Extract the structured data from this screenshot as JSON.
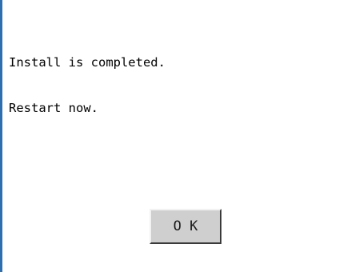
{
  "dialog": {
    "message_lines": [
      "Install is completed.",
      "Restart now."
    ],
    "ok_label": "O K"
  },
  "colors": {
    "background": "#ffffff",
    "frame_border": "#2e6fb0",
    "button_face": "#cfcfcf",
    "text": "#000000"
  }
}
